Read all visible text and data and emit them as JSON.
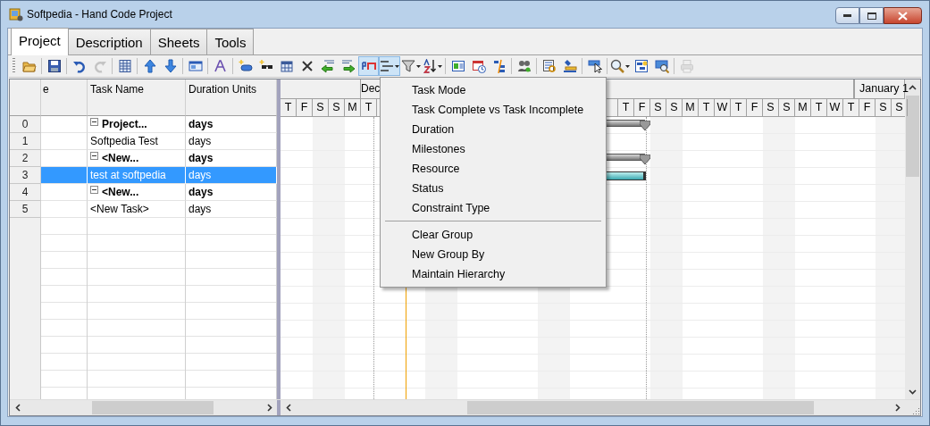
{
  "window": {
    "title": "Softpedia - Hand Code Project"
  },
  "tabs": [
    {
      "label": "Project",
      "selected": true
    },
    {
      "label": "Description",
      "selected": false
    },
    {
      "label": "Sheets",
      "selected": false
    },
    {
      "label": "Tools",
      "selected": false
    }
  ],
  "toolbar": {
    "buttons": [
      {
        "pressed": false,
        "disabled": false
      },
      {
        "pressed": false,
        "disabled": false
      },
      {
        "pressed": false,
        "disabled": false
      },
      {
        "pressed": false,
        "disabled": true
      },
      {
        "pressed": false,
        "disabled": false
      },
      {
        "pressed": false,
        "disabled": false
      },
      {
        "pressed": false,
        "disabled": false
      },
      {
        "pressed": false,
        "disabled": false
      },
      {
        "pressed": false,
        "disabled": false
      },
      {
        "pressed": false,
        "disabled": false
      },
      {
        "pressed": false,
        "disabled": false
      },
      {
        "pressed": false,
        "disabled": false
      },
      {
        "pressed": false,
        "disabled": false
      },
      {
        "pressed": false,
        "disabled": false
      },
      {
        "pressed": false,
        "disabled": false
      },
      {
        "pressed": true,
        "disabled": false
      },
      {
        "pressed": true,
        "disabled": false
      },
      {
        "pressed": false,
        "disabled": false
      },
      {
        "pressed": false,
        "disabled": false
      },
      {
        "pressed": false,
        "disabled": false
      },
      {
        "pressed": false,
        "disabled": false
      },
      {
        "pressed": false,
        "disabled": false
      },
      {
        "pressed": false,
        "disabled": false
      },
      {
        "pressed": false,
        "disabled": false
      },
      {
        "pressed": false,
        "disabled": false
      },
      {
        "pressed": false,
        "disabled": false
      },
      {
        "pressed": false,
        "disabled": false
      },
      {
        "pressed": false,
        "disabled": false
      },
      {
        "pressed": false,
        "disabled": false
      },
      {
        "pressed": false,
        "disabled": true
      }
    ]
  },
  "task_grid": {
    "columns": [
      {
        "label": "e"
      },
      {
        "label": "Task Name"
      },
      {
        "label": "Duration Units"
      }
    ],
    "tasks": [
      {
        "row": "0",
        "name": "Project...",
        "duration": "days",
        "expanded": true,
        "selected": false,
        "bar": {
          "kind": "summary"
        },
        "children": [
          {
            "row": "1",
            "name": "Softpedia Test",
            "duration": "days",
            "selected": false
          },
          {
            "row": "2",
            "name": "<New...",
            "duration": "days",
            "expanded": true,
            "selected": false,
            "bar": {
              "kind": "summary"
            },
            "children": [
              {
                "row": "3",
                "name": "test at softpedia",
                "duration": "days",
                "selected": true,
                "bar": {
                  "kind": "task"
                }
              }
            ]
          },
          {
            "row": "4",
            "name": "<New...",
            "duration": "days",
            "expanded": true,
            "selected": false,
            "children": [
              {
                "row": "5",
                "name": "<New Task>",
                "duration": "days",
                "selected": false
              }
            ]
          }
        ]
      }
    ]
  },
  "gantt": {
    "months": [
      {
        "label": "Dec"
      },
      {
        "label": "January 1"
      }
    ],
    "days_before_menu": [
      "T",
      "F",
      "S",
      "S",
      "M",
      "T"
    ],
    "days_after_menu": [
      "T",
      "F",
      "S",
      "S",
      "M",
      "T",
      "W",
      "T",
      "F",
      "S",
      "S",
      "M",
      "T",
      "W",
      "T",
      "F",
      "S",
      "S"
    ]
  },
  "group_menu": {
    "sections": [
      [
        "Task Mode",
        "Task Complete vs Task Incomplete",
        "Duration",
        "Milestones",
        "Resource",
        "Status",
        "Constraint Type"
      ],
      [
        "Clear Group",
        "New Group By",
        "Maintain Hierarchy"
      ]
    ]
  }
}
